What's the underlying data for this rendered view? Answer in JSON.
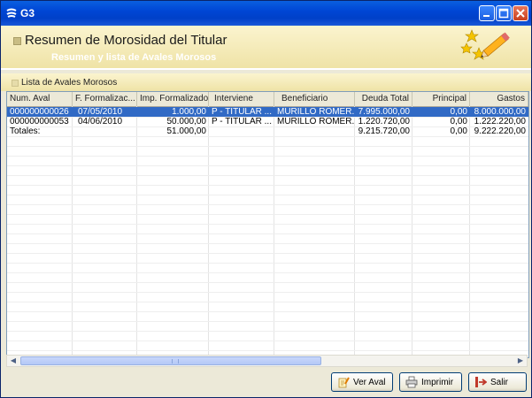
{
  "window": {
    "title": "G3"
  },
  "header": {
    "title": "Resumen de Morosidad del Titular",
    "subtitle": "Resumen y lista de Avales Morosos"
  },
  "section": {
    "title": "Lista de Avales Morosos"
  },
  "table": {
    "columns": [
      "Num. Aval",
      "F. Formalizac...",
      "Imp. Formalizado",
      "Interviene",
      "Beneficiario",
      "Deuda Total",
      "Principal",
      "Gastos"
    ],
    "rows": [
      [
        "000000000026",
        "07/05/2010",
        "1.000,00",
        "P - TITULAR ...",
        "MURILLO ROMER...",
        "7.995.000,00",
        "0,00",
        "8.000.000,00"
      ],
      [
        "000000000053",
        "04/06/2010",
        "50.000,00",
        "P - TITULAR ...",
        "MURILLO ROMER...",
        "1.220.720,00",
        "0,00",
        "1.222.220,00"
      ],
      [
        "Totales:",
        "",
        "51.000,00",
        "",
        "",
        "9.215.720,00",
        "0,00",
        "9.222.220,00"
      ]
    ],
    "selected_row": 0
  },
  "buttons": {
    "ver_aval": "Ver Aval",
    "imprimir": "Imprimir",
    "salir": "Salir"
  },
  "colors": {
    "title_bar": "#0046d5",
    "header_bg": "#f4ecbf",
    "selection": "#316ac5"
  }
}
